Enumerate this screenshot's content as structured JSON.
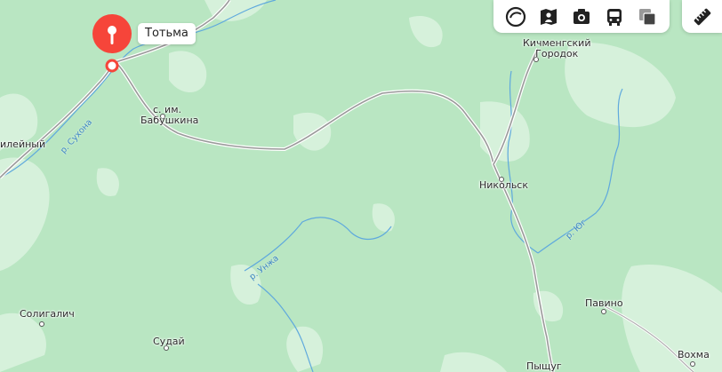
{
  "map": {
    "colors": {
      "forest": "#b9e6c2",
      "open_land": "#d6f1db",
      "water": "#5fa9dd",
      "road": "#9a9a9a",
      "road_casing": "#ffffff",
      "pin": "#f6453a"
    },
    "selected_place": {
      "label": "Тотьма"
    },
    "places": {
      "kichmengsky_line1": "Кичменгский",
      "kichmengsky_line2": "Городок",
      "babushkina_line1": "с. им.",
      "babushkina_line2": "Бабушкина",
      "nikolsk": "Никольск",
      "soligalich": "Солигалич",
      "sudai": "Судай",
      "pavino": "Павино",
      "vokhma": "Вохма",
      "pyshchug": "Пыщуг",
      "ileyny": "илейный"
    },
    "rivers": {
      "sukhona": "р. Сухона",
      "unzha": "р. Унжа",
      "yug": "р. Юг"
    }
  },
  "toolbar": {
    "icons": [
      "layers-icon",
      "panorama-icon",
      "photo-icon",
      "transport-icon",
      "map-layers-icon"
    ],
    "ruler_icon": "ruler-icon"
  }
}
